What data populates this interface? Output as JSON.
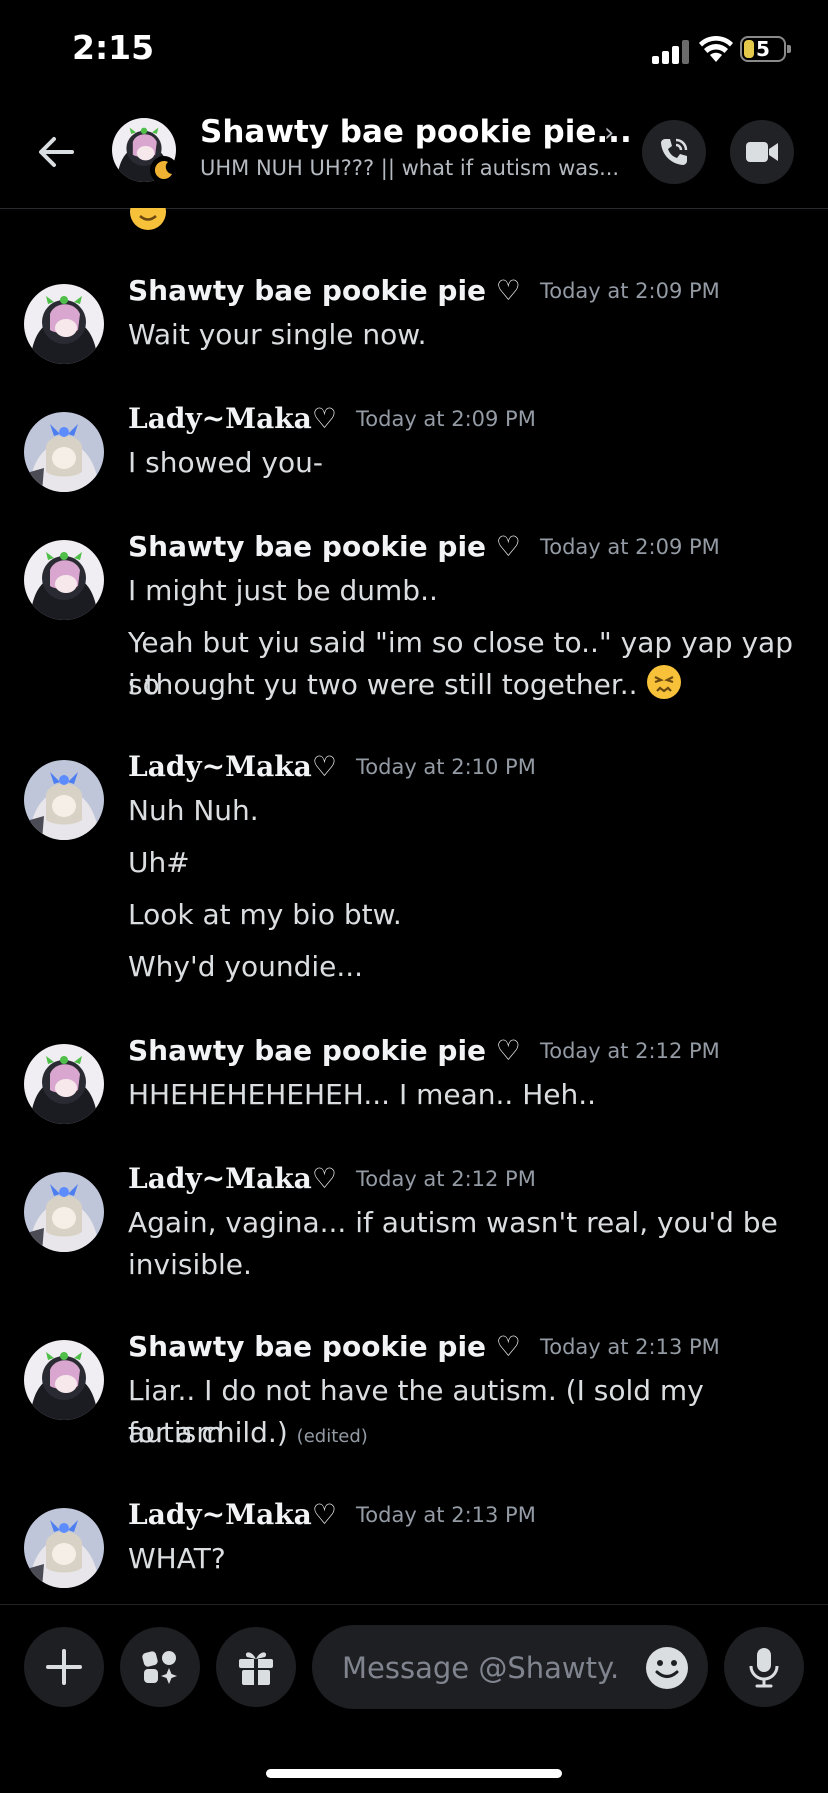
{
  "status_bar": {
    "time": "2:15",
    "battery": "5"
  },
  "header": {
    "title": "Shawty bae pookie pie...",
    "subtitle": "UHM NUH UH??? || what if autism was..."
  },
  "messages": [
    {
      "author": "Shawty bae pookie pie ♡",
      "time": "Today at 2:09 PM",
      "lines": [
        "Wait your single now."
      ]
    },
    {
      "author": "Lady~Maka♡",
      "time": "Today at 2:09 PM",
      "lines": [
        "I showed you-"
      ]
    },
    {
      "author": "Shawty bae pookie pie ♡",
      "time": "Today at 2:09 PM",
      "lines": [
        "I might just be dumb..",
        "Yeah but yiu said \"im so close to..\" yap yap yap so",
        "i thought yu two were still together.. "
      ]
    },
    {
      "author": "Lady~Maka♡",
      "time": "Today at 2:10 PM",
      "lines": [
        "Nuh Nuh.",
        "Uh#",
        "Look at my bio btw.",
        "Why'd youndie..."
      ]
    },
    {
      "author": "Shawty bae pookie pie ♡",
      "time": "Today at 2:12 PM",
      "lines": [
        "HHEHEHEHEHEH... I mean.. Heh.."
      ]
    },
    {
      "author": "Lady~Maka♡",
      "time": "Today at 2:12 PM",
      "lines": [
        "Again, vagina... if autism wasn't real, you'd be",
        "invisible."
      ]
    },
    {
      "author": "Shawty bae pookie pie ♡",
      "time": "Today at 2:13 PM",
      "lines": [
        "Liar.. I do not have the autism. (I sold my autism",
        "for a child.)"
      ],
      "edited": "(edited)"
    },
    {
      "author": "Lady~Maka♡",
      "time": "Today at 2:13 PM",
      "lines": [
        "WHAT?"
      ]
    }
  ],
  "composer": {
    "placeholder": "Message @Shawty..."
  },
  "colors": {
    "background": "#000000",
    "surface": "#1e1f22",
    "muted": "#949ba4",
    "text": "#dbdee1",
    "accent_battery": "#e5c94a"
  }
}
